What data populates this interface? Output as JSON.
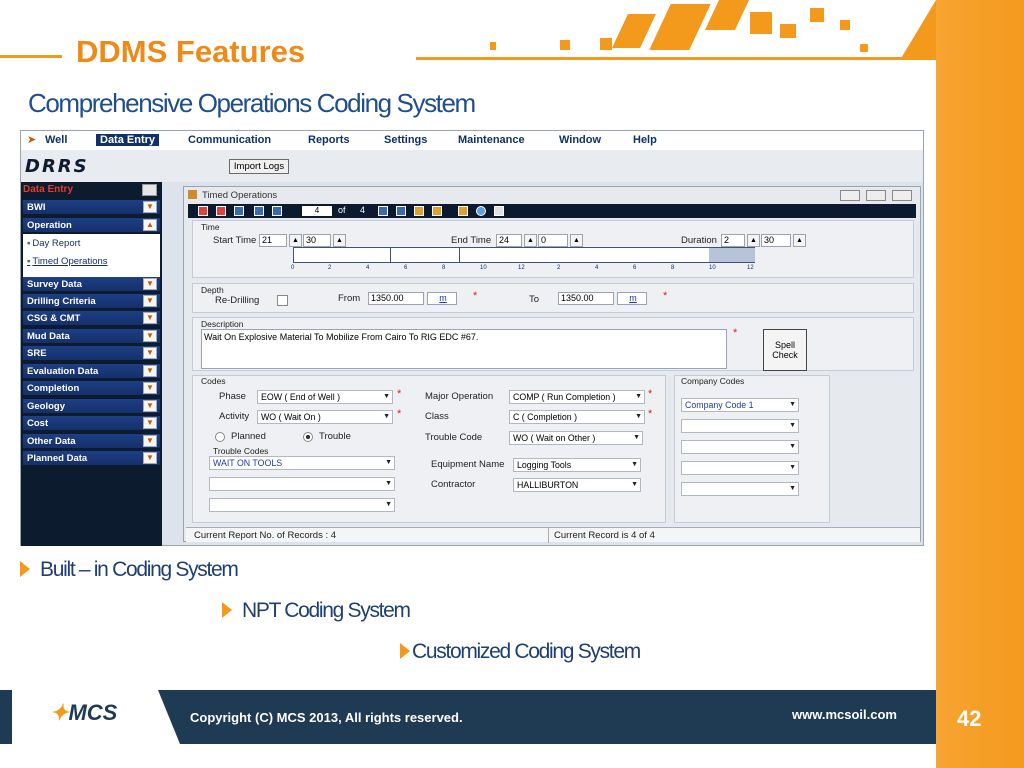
{
  "slide": {
    "title": "DDMS Features",
    "subtitle": "Comprehensive Operations Coding System",
    "bullets": [
      "Built – in Coding System",
      "NPT Coding System",
      "Customized Coding System"
    ],
    "copyright": "Copyright (C) MCS 2013, All rights reserved.",
    "website": "www.mcsoil.com",
    "page_number": "42",
    "logo_text": "MCS",
    "colors": {
      "accent": "#f39a1d",
      "title": "#f08a16",
      "subtitle": "#1f4e8c",
      "footer": "#1f3a53"
    }
  },
  "app": {
    "menu": [
      "Well",
      "Data Entry",
      "Communication",
      "Reports",
      "Settings",
      "Maintenance",
      "Window",
      "Help"
    ],
    "active_menu": "Data Entry",
    "logo_text": "DRRS",
    "import_button": "Import Logs",
    "nav": {
      "header": "Data Entry",
      "items": [
        "BWI",
        "Operation",
        "Survey Data",
        "Drilling Criteria",
        "CSG & CMT",
        "Mud Data",
        "SRE",
        "Evaluation Data",
        "Completion",
        "Geology",
        "Cost",
        "Other Data",
        "Planned Data"
      ],
      "subitems": [
        "Day Report",
        "Timed Operations"
      ]
    },
    "window": {
      "title": "Timed Operations",
      "record_current": "4",
      "record_of": "of",
      "record_total": "4",
      "time": {
        "group_label": "Time",
        "start_label": "Start Time",
        "start_hour": "21",
        "start_min": "30",
        "end_label": "End Time",
        "end_hour": "24",
        "end_min": "0",
        "duration_label": "Duration",
        "duration_hour": "2",
        "duration_min": "30",
        "timeline_ticks": [
          "0",
          "2",
          "4",
          "6",
          "8",
          "10",
          "12",
          "2",
          "4",
          "6",
          "8",
          "10",
          "12"
        ]
      },
      "depth": {
        "group_label": "Depth",
        "redrilling_label": "Re-Drilling",
        "from_label": "From",
        "from_value": "1350.00",
        "from_unit": "m",
        "to_label": "To",
        "to_value": "1350.00",
        "to_unit": "m"
      },
      "description": {
        "group_label": "Description",
        "text": "Wait On Explosive Material To Mobilize From Cairo To RIG EDC #67.",
        "spell_check": "Spell Check"
      },
      "codes": {
        "group_label": "Codes",
        "phase_label": "Phase",
        "phase_value": "EOW ( End of Well )",
        "activity_label": "Activity",
        "activity_value": "WO ( Wait On )",
        "major_op_label": "Major Operation",
        "major_op_value": "COMP ( Run Completion )",
        "class_label": "Class",
        "class_value": "C ( Completion )",
        "planned_label": "Planned",
        "trouble_label": "Trouble",
        "trouble_code_label": "Trouble Code",
        "trouble_code_value": "WO ( Wait on Other )",
        "trouble_codes_label": "Trouble Codes",
        "trouble_codes": [
          "WAIT ON TOOLS",
          "",
          ""
        ],
        "equipment_label": "Equipment Name",
        "equipment_value": "Logging Tools",
        "contractor_label": "Contractor",
        "contractor_value": "HALLIBURTON"
      },
      "company_codes": {
        "group_label": "Company Codes",
        "values": [
          "Company Code 1",
          "",
          "",
          "",
          ""
        ]
      },
      "status": {
        "left": "Current Report No. of Records : 4",
        "right": "Current Record is 4 of 4"
      }
    }
  }
}
